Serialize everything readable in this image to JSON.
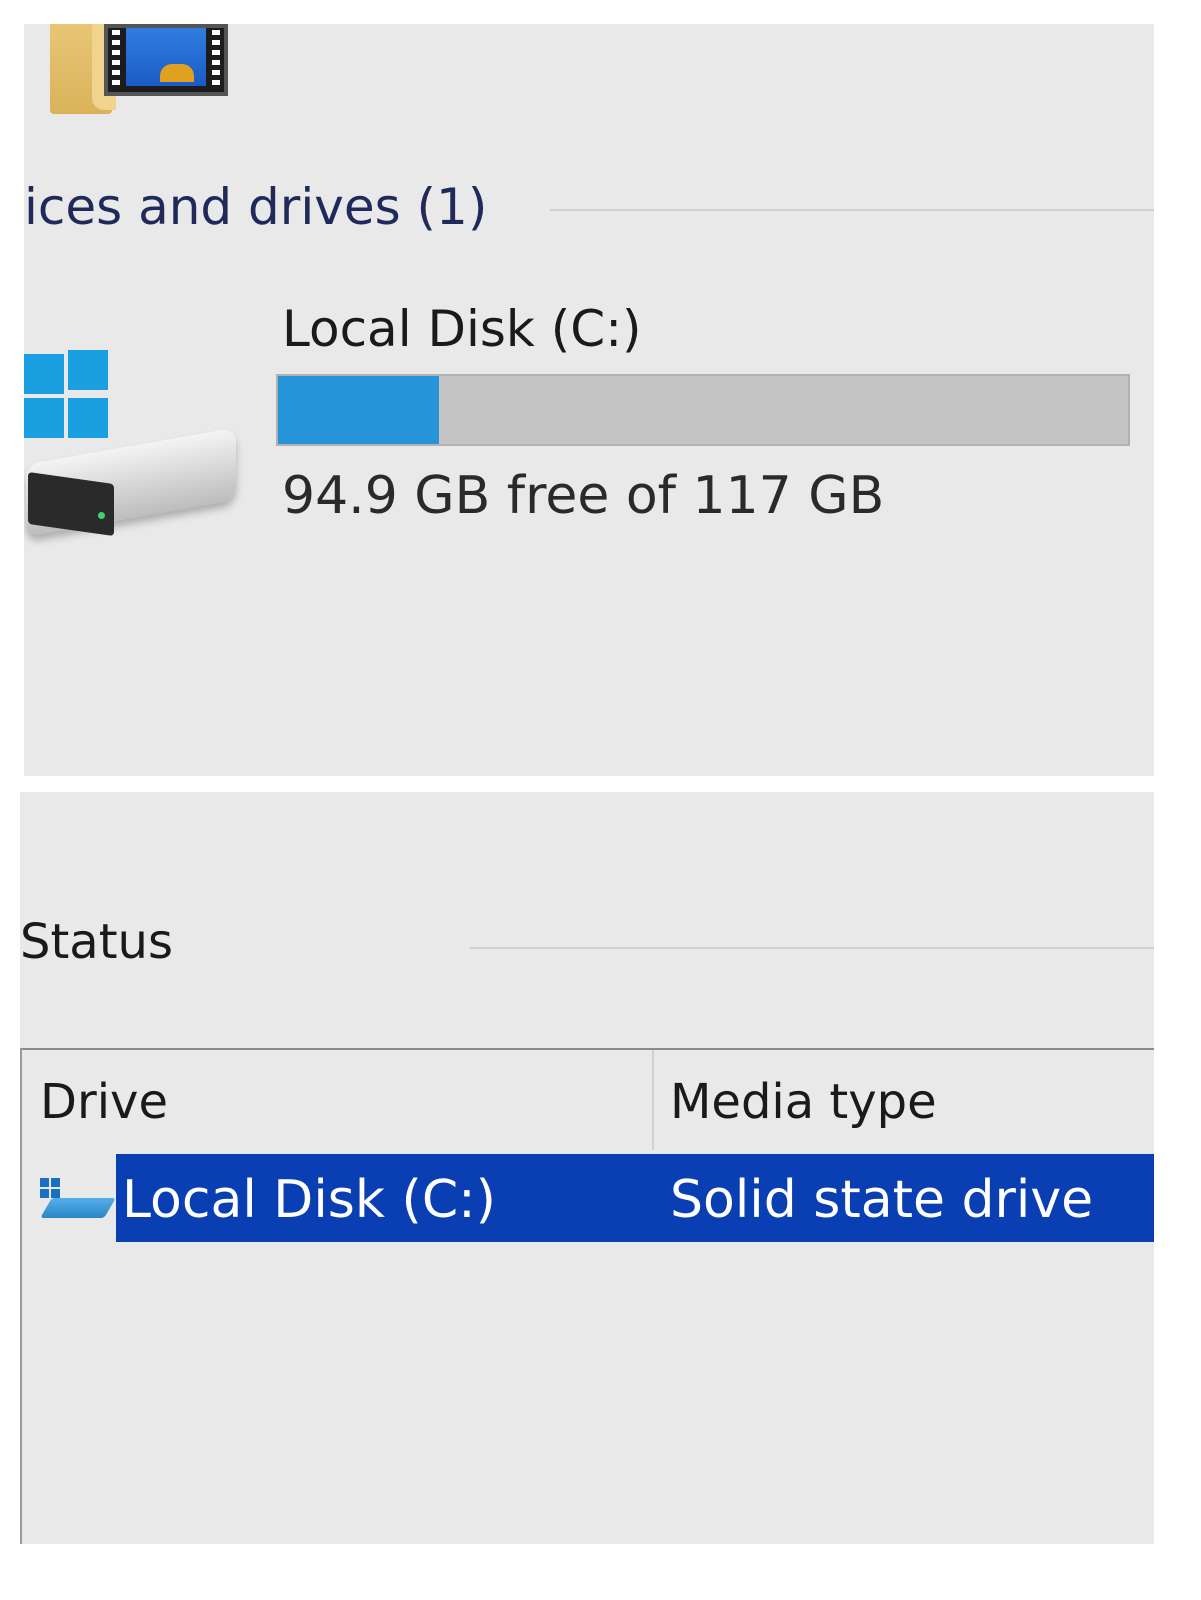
{
  "explorer": {
    "group_header": "ices and drives (1)",
    "drive": {
      "name": "Local Disk (C:)",
      "free_text": "94.9 GB free of 117 GB",
      "used_fraction": 0.189,
      "icon": "hard-drive-windows-icon"
    },
    "top_icons": [
      "folder-icon",
      "video-film-icon"
    ]
  },
  "optimize": {
    "status_label": "Status",
    "columns": {
      "drive": "Drive",
      "media_type": "Media type"
    },
    "rows": [
      {
        "drive": "Local Disk (C:)",
        "media_type": "Solid state drive",
        "selected": true,
        "icon": "drive-icon"
      }
    ]
  },
  "colors": {
    "usage_fill": "#2594d8",
    "usage_track": "#c4c4c4",
    "selection": "#0a3fb3",
    "background": "#e9e9e9"
  }
}
